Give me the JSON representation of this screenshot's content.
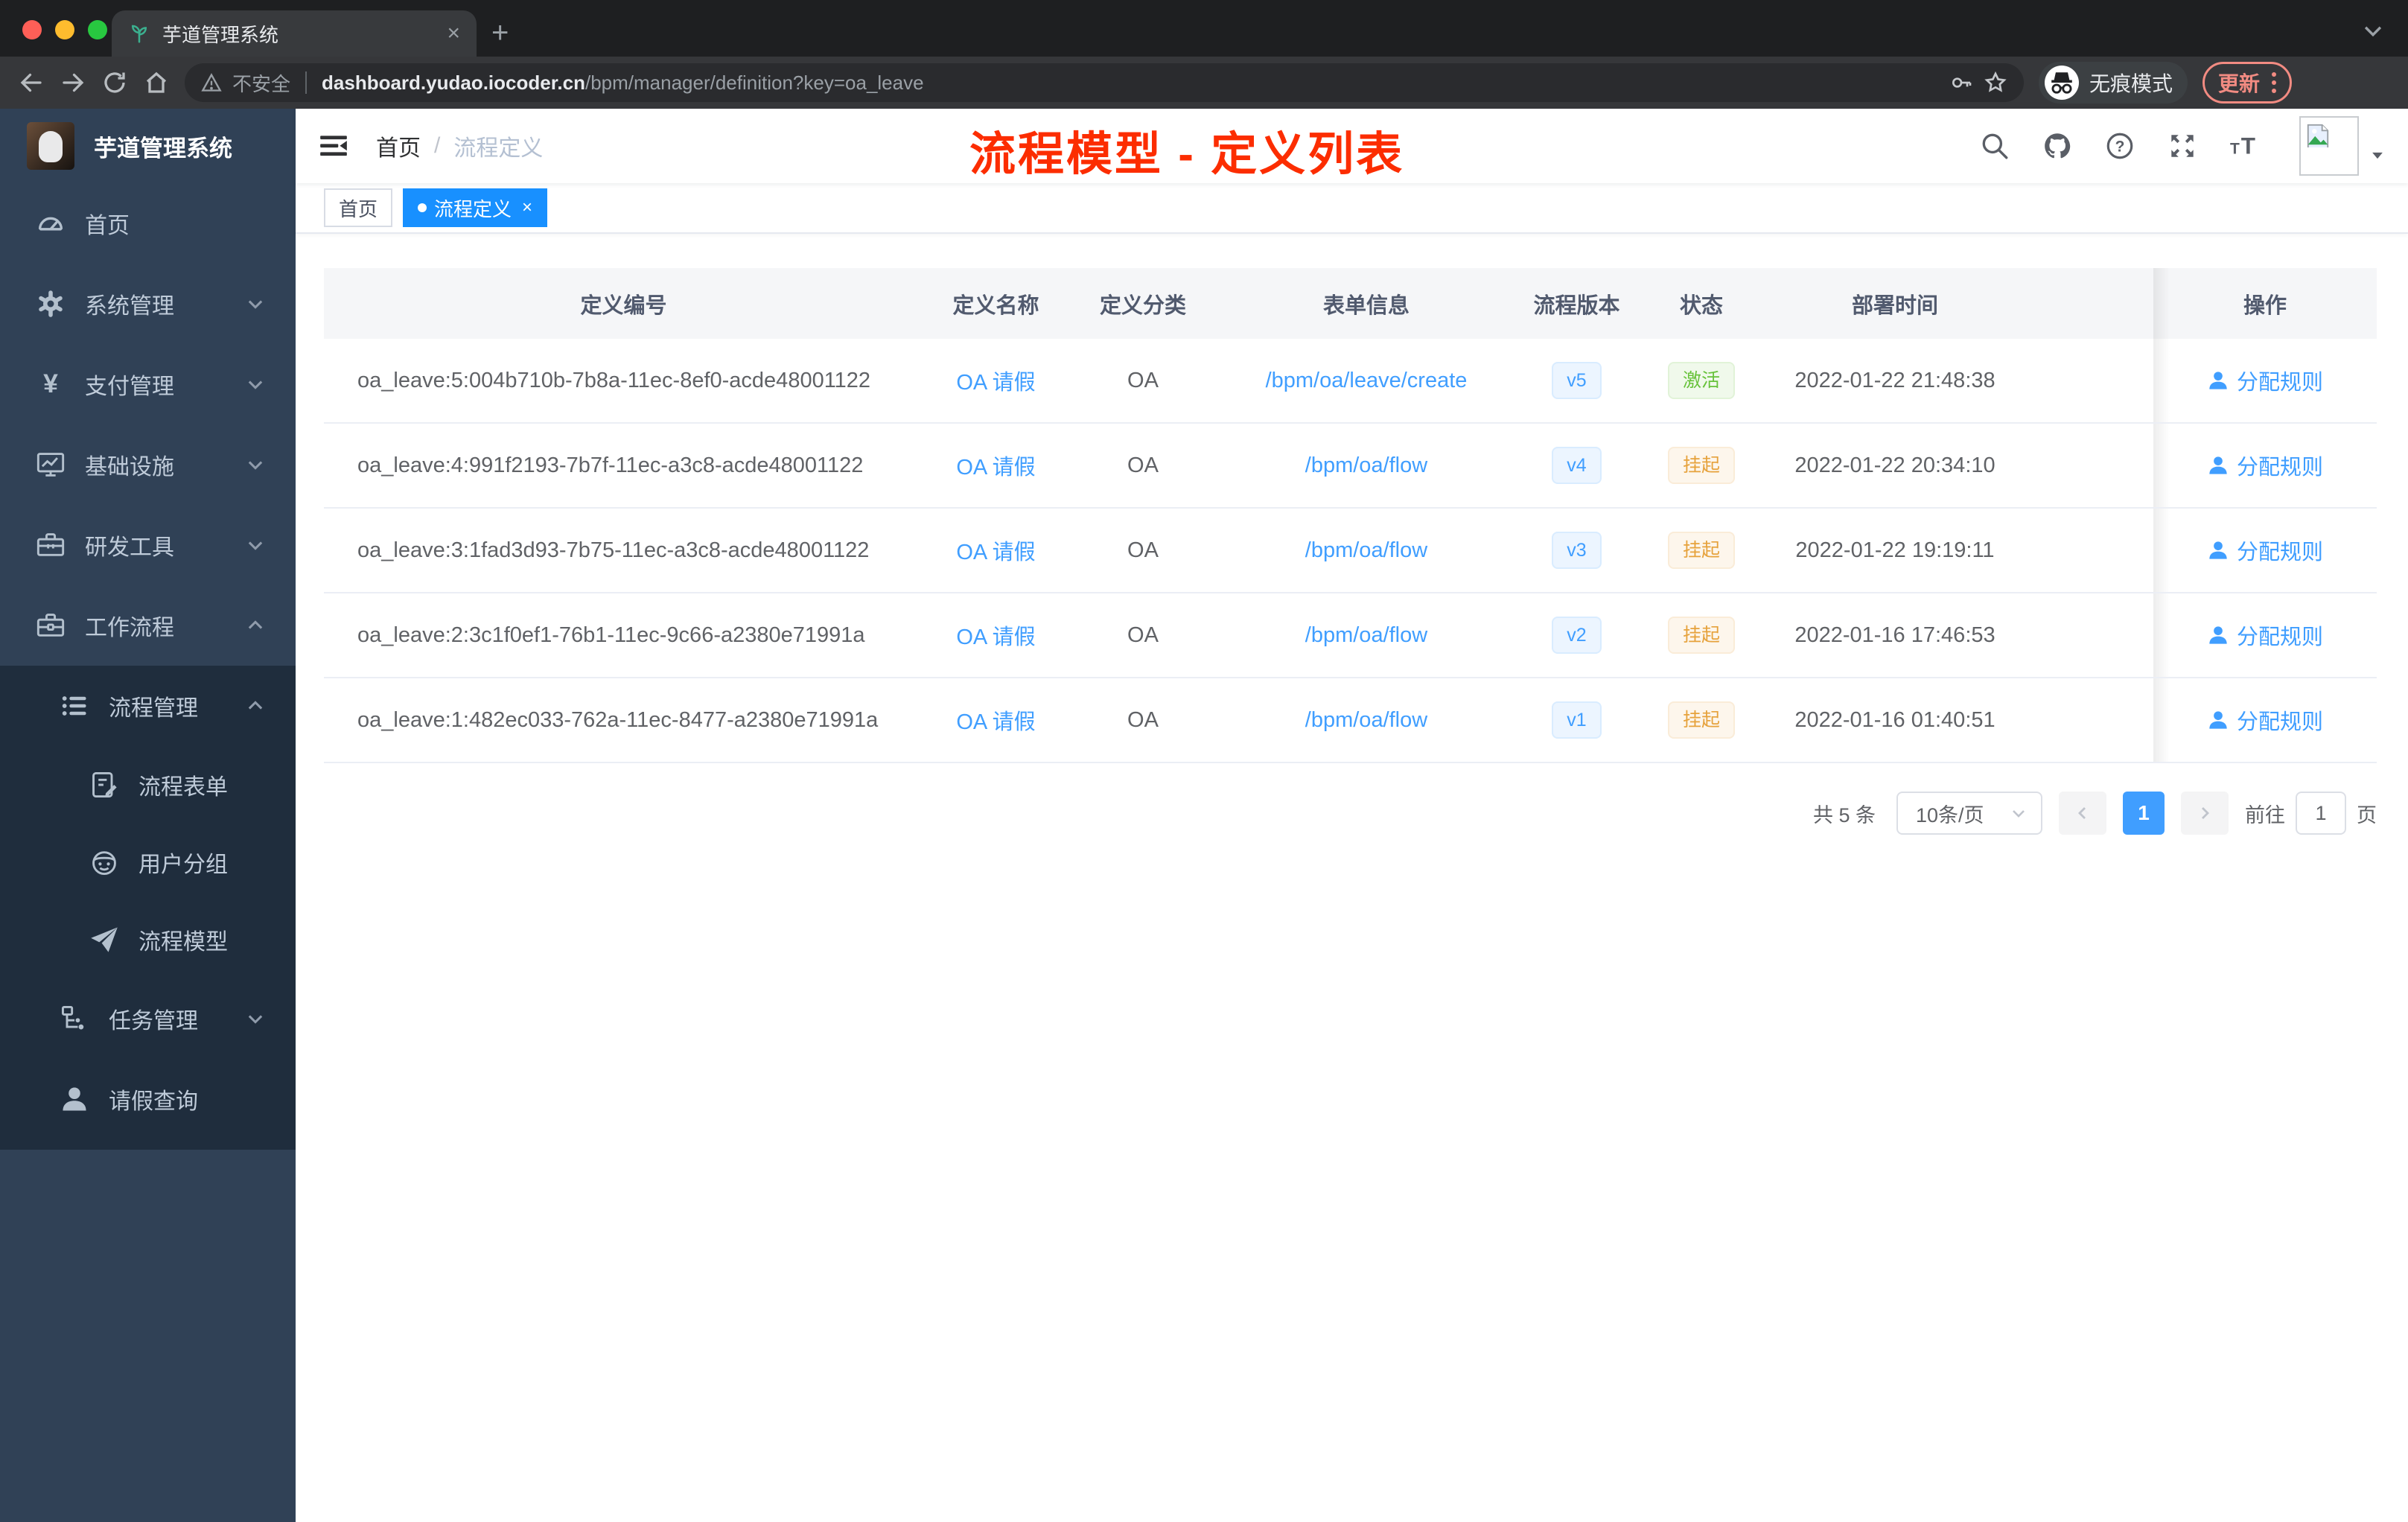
{
  "colors": {
    "accent_blue": "#409eff",
    "tag_active_blue": "#1890ff",
    "success_green": "#67c23a",
    "warning_orange": "#e6a23c",
    "annotation_red": "#fc2d00",
    "update_salmon": "#f28b82",
    "sidebar_bg": "#304156",
    "submenu_bg": "#1f2d3d",
    "sidebar_text": "#bfcbd9"
  },
  "browser": {
    "tab_title": "芋道管理系统",
    "tab_close": "×",
    "new_tab": "+",
    "security_label": "不安全",
    "url_domain": "dashboard.yudao.iocoder.cn",
    "url_path": "/bpm/manager/definition?key=oa_leave",
    "incognito_label": "无痕模式",
    "update_label": "更新"
  },
  "sidebar": {
    "logo_title": "芋道管理系统",
    "menu": [
      {
        "label": "首页",
        "icon": "dashboard-icon",
        "level": 1,
        "chevron": null,
        "dark": false
      },
      {
        "label": "系统管理",
        "icon": "gear-icon",
        "level": 1,
        "chevron": "down",
        "dark": false
      },
      {
        "label": "支付管理",
        "icon": "yen-icon",
        "level": 1,
        "chevron": "down",
        "dark": false
      },
      {
        "label": "基础设施",
        "icon": "monitor-icon",
        "level": 1,
        "chevron": "down",
        "dark": false
      },
      {
        "label": "研发工具",
        "icon": "toolbox-icon",
        "level": 1,
        "chevron": "down",
        "dark": false
      },
      {
        "label": "工作流程",
        "icon": "briefcase-icon",
        "level": 1,
        "chevron": "up",
        "dark": false
      },
      {
        "label": "流程管理",
        "icon": "list-icon",
        "level": 2,
        "chevron": "up",
        "dark": true
      },
      {
        "label": "流程表单",
        "icon": "form-icon",
        "level": 3,
        "chevron": null,
        "dark": true
      },
      {
        "label": "用户分组",
        "icon": "robot-icon",
        "level": 3,
        "chevron": null,
        "dark": true
      },
      {
        "label": "流程模型",
        "icon": "plane-icon",
        "level": 3,
        "chevron": null,
        "dark": true
      },
      {
        "label": "任务管理",
        "icon": "tasks-icon",
        "level": 2,
        "chevron": "down",
        "dark": true
      },
      {
        "label": "请假查询",
        "icon": "person-icon",
        "level": 2,
        "chevron": null,
        "dark": true
      }
    ]
  },
  "header": {
    "breadcrumb_home": "首页",
    "breadcrumb_separator": "/",
    "breadcrumb_current": "流程定义",
    "annotation": "流程模型 - 定义列表"
  },
  "tags": [
    {
      "label": "首页",
      "active": false
    },
    {
      "label": "流程定义",
      "active": true,
      "close": "×"
    }
  ],
  "table": {
    "columns": [
      "定义编号",
      "定义名称",
      "定义分类",
      "表单信息",
      "流程版本",
      "状态",
      "部署时间",
      "操作"
    ],
    "rows": [
      {
        "id": "oa_leave:5:004b710b-7b8a-11ec-8ef0-acde48001122",
        "name": "OA 请假",
        "category": "OA",
        "form": "/bpm/oa/leave/create",
        "version": "v5",
        "status": "激活",
        "status_type": "success",
        "time": "2022-01-22 21:48:38",
        "action": "分配规则"
      },
      {
        "id": "oa_leave:4:991f2193-7b7f-11ec-a3c8-acde48001122",
        "name": "OA 请假",
        "category": "OA",
        "form": "/bpm/oa/flow",
        "version": "v4",
        "status": "挂起",
        "status_type": "warning",
        "time": "2022-01-22 20:34:10",
        "action": "分配规则"
      },
      {
        "id": "oa_leave:3:1fad3d93-7b75-11ec-a3c8-acde48001122",
        "name": "OA 请假",
        "category": "OA",
        "form": "/bpm/oa/flow",
        "version": "v3",
        "status": "挂起",
        "status_type": "warning",
        "time": "2022-01-22 19:19:11",
        "action": "分配规则"
      },
      {
        "id": "oa_leave:2:3c1f0ef1-76b1-11ec-9c66-a2380e71991a",
        "name": "OA 请假",
        "category": "OA",
        "form": "/bpm/oa/flow",
        "version": "v2",
        "status": "挂起",
        "status_type": "warning",
        "time": "2022-01-16 17:46:53",
        "action": "分配规则"
      },
      {
        "id": "oa_leave:1:482ec033-762a-11ec-8477-a2380e71991a",
        "name": "OA 请假",
        "category": "OA",
        "form": "/bpm/oa/flow",
        "version": "v1",
        "status": "挂起",
        "status_type": "warning",
        "time": "2022-01-16 01:40:51",
        "action": "分配规则"
      }
    ]
  },
  "pagination": {
    "total": "共 5 条",
    "page_size": "10条/页",
    "current_page": "1",
    "goto_label": "前往",
    "goto_value": "1",
    "page_unit": "页"
  }
}
